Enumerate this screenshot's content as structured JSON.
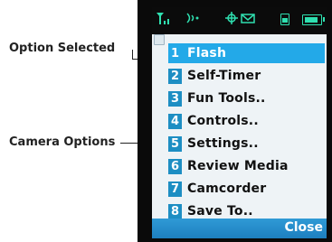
{
  "callouts": {
    "option_selected": "Option Selected",
    "camera_options": "Camera Options"
  },
  "status_bar": {
    "signal_icon": "signal-strength-icon",
    "roaming_icon": "wireless-icon",
    "sim_icon": "sim-card-icon",
    "battery_icon": "battery-icon",
    "battery_level": 0.85,
    "accent_color": "#2fe0b0"
  },
  "menu": {
    "selected_index": 0,
    "items": [
      {
        "number": "1",
        "label": "Flash"
      },
      {
        "number": "2",
        "label": "Self-Timer"
      },
      {
        "number": "3",
        "label": "Fun Tools.."
      },
      {
        "number": "4",
        "label": "Controls.."
      },
      {
        "number": "5",
        "label": "Settings.."
      },
      {
        "number": "6",
        "label": "Review Media"
      },
      {
        "number": "7",
        "label": "Camcorder"
      },
      {
        "number": "8",
        "label": "Save To.."
      }
    ],
    "highlight_color": "#23a9e8",
    "number_badge_color": "#1d8ec3"
  },
  "softkeys": {
    "right": "Close"
  }
}
